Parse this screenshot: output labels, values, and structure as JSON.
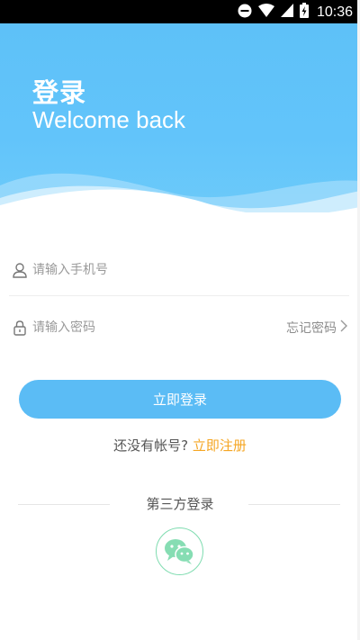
{
  "status_bar": {
    "time": "10:36"
  },
  "header": {
    "title": "登录",
    "subtitle": "Welcome back"
  },
  "form": {
    "phone_placeholder": "请输入手机号",
    "password_placeholder": "请输入密码",
    "forgot_password": "忘记密码"
  },
  "actions": {
    "login_button": "立即登录",
    "no_account_text": "还没有帐号?",
    "register_link": "立即注册"
  },
  "third_party": {
    "label": "第三方登录",
    "wechat_icon": "wechat-icon"
  },
  "colors": {
    "primary": "#5bbcf5",
    "header": "#62c4fa",
    "link": "#f5a623",
    "wechat": "#7fdcb0"
  }
}
